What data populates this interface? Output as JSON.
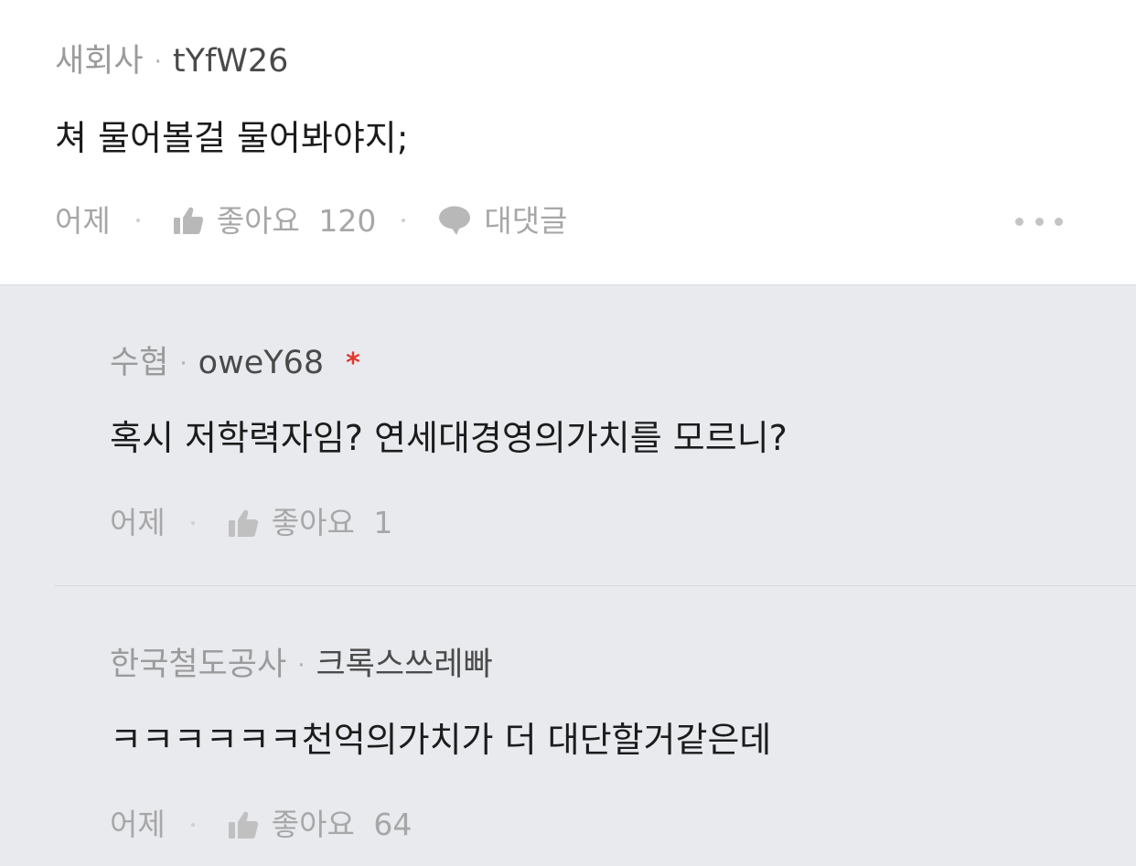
{
  "top_comment": {
    "company": "새회사",
    "nickname": "tYfW26",
    "text": "쳐 물어볼걸 물어봐야지;",
    "time": "어제",
    "like_label": "좋아요",
    "like_count": "120",
    "reply_label": "대댓글"
  },
  "replies": [
    {
      "company": "수협",
      "nickname": "oweY68",
      "badge": "*",
      "text": "혹시 저학력자임? 연세대경영의가치를 모르니?",
      "time": "어제",
      "like_label": "좋아요",
      "like_count": "1"
    },
    {
      "company": "한국철도공사",
      "nickname": "크록스쓰레빠",
      "text": "ㅋㅋㅋㅋㅋㅋ천억의가치가 더 대단할거같은데",
      "time": "어제",
      "like_label": "좋아요",
      "like_count": "64"
    }
  ],
  "icons": {
    "like": "thumbs-up-icon",
    "reply": "speech-bubble-icon",
    "more": "more-horizontal-icon"
  },
  "colors": {
    "reply_background": "#e9eaee",
    "author_badge": "#e0392e"
  }
}
